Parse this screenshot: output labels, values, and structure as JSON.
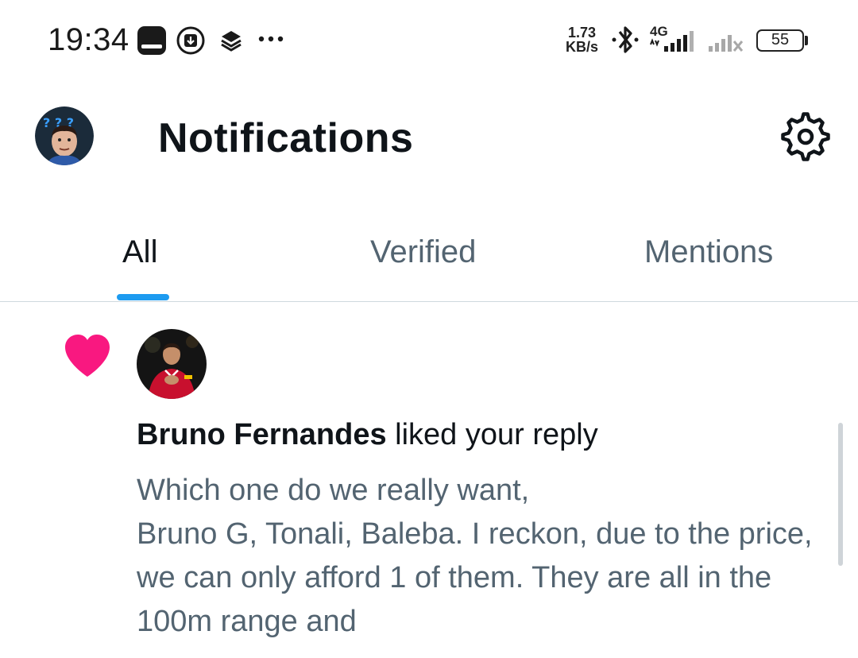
{
  "status_bar": {
    "time": "19:34",
    "net_rate_value": "1.73",
    "net_rate_unit": "KB/s",
    "network_type": "4G",
    "battery": "55",
    "icons": [
      "app-icon",
      "download-icon",
      "layers-icon",
      "more-dots-icon",
      "bluetooth-icon",
      "signal-icon",
      "signal-no-service-icon",
      "battery-icon"
    ]
  },
  "header": {
    "title": "Notifications",
    "avatar_icon": "profile-avatar",
    "settings_icon": "gear-icon"
  },
  "tabs": [
    {
      "label": "All",
      "selected": true
    },
    {
      "label": "Verified",
      "selected": false
    },
    {
      "label": "Mentions",
      "selected": false
    }
  ],
  "notification": {
    "type_icon": "heart-icon",
    "actor": "Bruno Fernandes",
    "action": " liked your reply",
    "text": "Which one do we really want,\nBruno G, Tonali, Baleba. I reckon, due to the price,  we can only afford 1 of them. They are all in the 100m range and"
  },
  "colors": {
    "accent": "#1d9bf0",
    "like": "#f91880",
    "secondary_text": "#536471",
    "primary_text": "#0f1419"
  }
}
